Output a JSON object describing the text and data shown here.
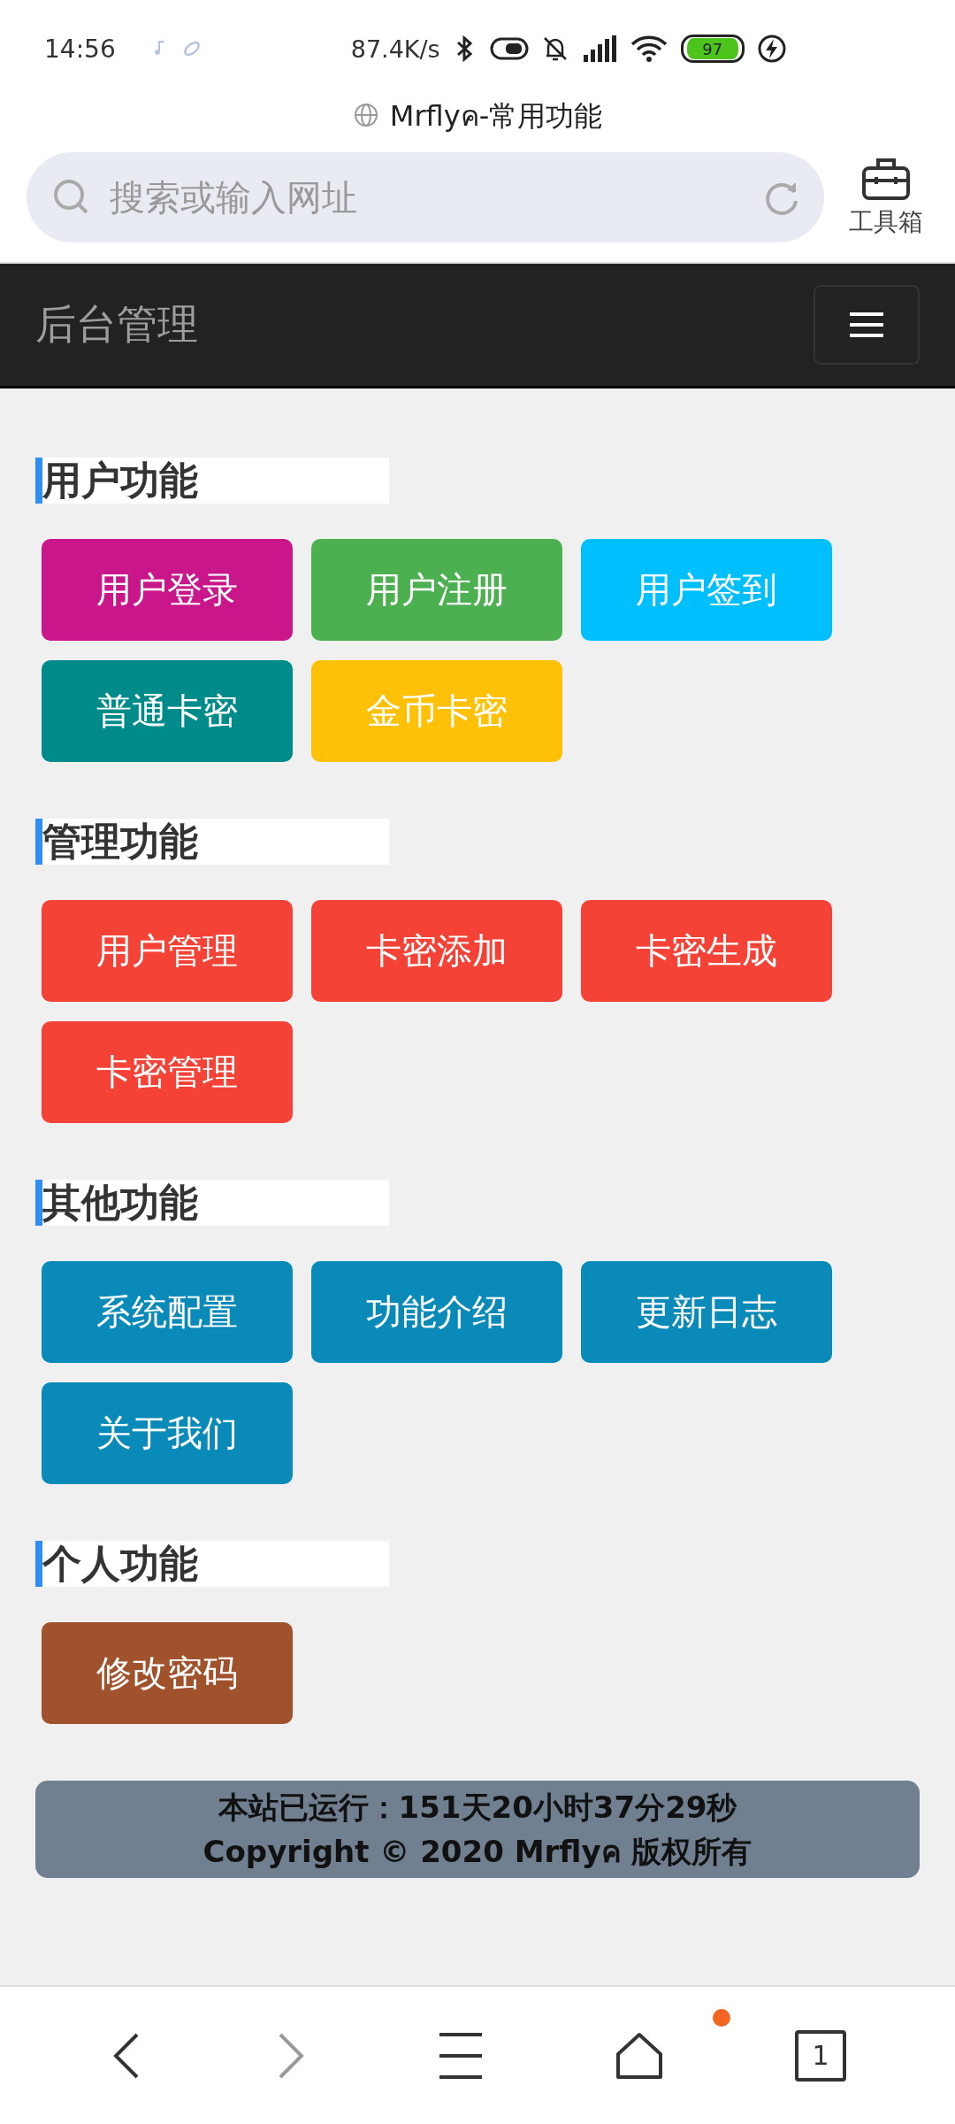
{
  "status_bar": {
    "time": "14:56",
    "net_speed": "87.4K/s",
    "battery": "97"
  },
  "browser": {
    "page_title": "Mrflyค-常用功能",
    "search": {
      "placeholder": "搜索或输入网址"
    },
    "toolbox_label": "工具箱"
  },
  "navbar": {
    "brand": "后台管理"
  },
  "sections": [
    {
      "title": "用户功能",
      "buttons": [
        {
          "label": "用户登录",
          "color": "#c9168a"
        },
        {
          "label": "用户注册",
          "color": "#4caf50"
        },
        {
          "label": "用户签到",
          "color": "#00bfff"
        },
        {
          "label": "普通卡密",
          "color": "#008b8b"
        },
        {
          "label": "金币卡密",
          "color": "#ffc107"
        }
      ]
    },
    {
      "title": "管理功能",
      "buttons": [
        {
          "label": "用户管理",
          "color": "#f44336"
        },
        {
          "label": "卡密添加",
          "color": "#f44336"
        },
        {
          "label": "卡密生成",
          "color": "#f44336"
        },
        {
          "label": "卡密管理",
          "color": "#f44336"
        }
      ]
    },
    {
      "title": "其他功能",
      "buttons": [
        {
          "label": "系统配置",
          "color": "#0a8ab8"
        },
        {
          "label": "功能介绍",
          "color": "#0a8ab8"
        },
        {
          "label": "更新日志",
          "color": "#0a8ab8"
        },
        {
          "label": "关于我们",
          "color": "#0a8ab8"
        }
      ]
    },
    {
      "title": "个人功能",
      "buttons": [
        {
          "label": "修改密码",
          "color": "#a0522d"
        }
      ]
    }
  ],
  "footer": {
    "lines": [
      "本站已运行：151天20小时37分29秒",
      "Copyright © 2020 Mrflyค 版权所有"
    ]
  },
  "bottom_nav": {
    "tab_count": "1"
  }
}
